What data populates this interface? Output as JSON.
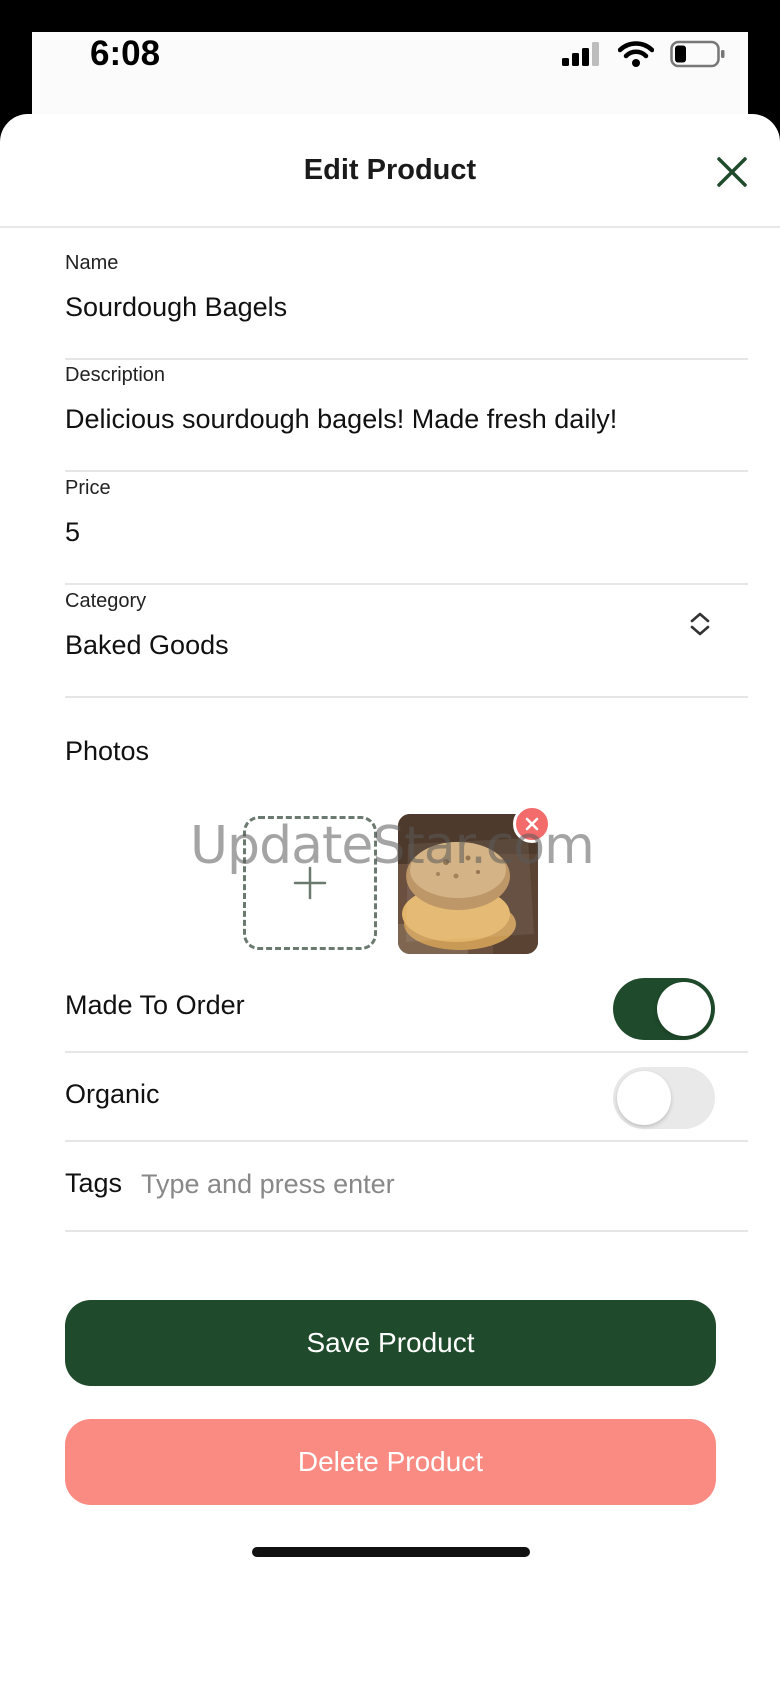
{
  "status_bar": {
    "time": "6:08"
  },
  "header": {
    "title": "Edit Product"
  },
  "form": {
    "name": {
      "label": "Name",
      "value": "Sourdough Bagels"
    },
    "description": {
      "label": "Description",
      "value": "Delicious sourdough bagels! Made fresh daily!"
    },
    "price": {
      "label": "Price",
      "value": "5"
    },
    "category": {
      "label": "Category",
      "value": "Baked Goods"
    },
    "photos": {
      "label": "Photos",
      "watermark": "UpdateStar.com"
    },
    "made_to_order": {
      "label": "Made To Order",
      "enabled": true
    },
    "organic": {
      "label": "Organic",
      "enabled": false
    },
    "tags": {
      "label": "Tags",
      "placeholder": "Type and press enter"
    }
  },
  "actions": {
    "save_label": "Save Product",
    "delete_label": "Delete Product"
  },
  "colors": {
    "primary": "#1f4a2b",
    "danger": "#f98b82",
    "remove_badge": "#f36b6b"
  },
  "icons": {
    "close": "close-icon",
    "select": "chevron-up-down-icon",
    "add_photo": "plus-icon",
    "remove_photo": "x-icon"
  }
}
